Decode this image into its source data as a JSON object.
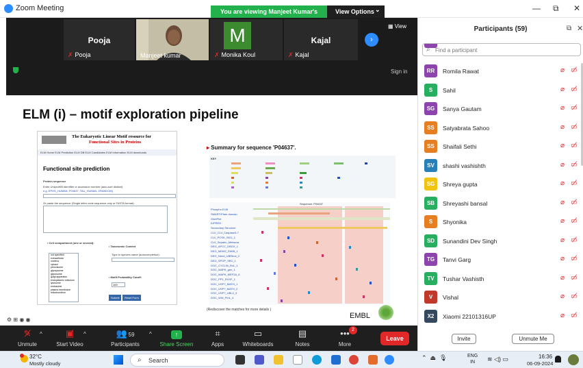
{
  "window": {
    "title": "Zoom Meeting",
    "share_banner": "You are viewing Manjeet Kumar's screen",
    "view_options": "View Options",
    "view_options_caret": "⌄",
    "minimize": "—",
    "maximize": "⧉",
    "close": "✕"
  },
  "gallery": {
    "tiles": [
      {
        "name": "Pooja",
        "label": "Pooja"
      },
      {
        "name": "",
        "label": "Manjeet kumar"
      },
      {
        "name": "M",
        "label": "Monika Koul"
      },
      {
        "name": "Kajal",
        "label": "Kajal"
      }
    ],
    "next_arrow": "›",
    "view_button": "▦ View",
    "sign_in": "Sign in",
    "mute_glyph": "✗"
  },
  "slide": {
    "title": "ELM (i) – motif exploration pipeline",
    "elm": {
      "name": "The Eukaryotic Linear Motif resource for",
      "subtitle": "Functional Sites in Proteins",
      "nav": "ELM Home   ELM Prediction   ELM DB   ELM Candidates   ELM Information   ELM downloads",
      "heading": "Functional site prediction",
      "protein_seq": "Protein sequence",
      "enter_hint": "Enter UniprotKB identifier or accession number (auto-sort distinct)",
      "example": "e.g. EPHS_HUMAN, P04637, TAU_HUMAN, ZRANDOM)",
      "paste_hint": "Or paste the sequence (Single letter code sequence only or FASTA format):",
      "cell_compartment": "• Cell compartment (one or several):",
      "taxonomic": "• Taxonomic Context",
      "species_hint": "Type in species name (autocompletion):",
      "motif_prob": "• Motif Probability Cutoff:",
      "cutoff": "100",
      "submit": "Submit",
      "reset": "Reset Form",
      "compartments": "not specified\nextracellular\nnucleus\ncytosol\nperoxisome\nglyoxysome\nglycosome\ngolgi apparatus\nendoplasmic reticulum\nlysosome\nendosome\nplasma membrane\nmitochondrion"
    },
    "summary": {
      "title": "Summary for sequence 'P04637'.",
      "key": "KEY",
      "footer": "(Rediscover the matches for more details )",
      "sequence_label": "Sequence: P04637",
      "rows": [
        "Phospho.ELM",
        "SMART/Pfam domain",
        "GlobPlot",
        "IUPRED",
        "Secondary Structure",
        "CLV_C14_Caspase3-7",
        "CLV_PCSK_SKI1_1",
        "CLV_Separin_Metazoa",
        "DEG_APCC_DBOX_1",
        "DEG_MDM2_SWIB_1",
        "DEG_Nend_UBRbox_2",
        "DEG_SPOP_SBC_1",
        "DOC_CYCLIN_RxL_1",
        "DOC_MAPK_gen_1",
        "DOC_MAPK_MEF2A_6",
        "DOC_PP1_RVXF_1",
        "DOC_USP7_MATH_1",
        "DOC_USP7_MATH_2",
        "DOC_USP7_UBL2_3",
        "DOC_WW_Pin1_4"
      ]
    },
    "embl": "EMBL",
    "annot_icons": "⚙ ⊞ ◉ ◉"
  },
  "toolbar": {
    "unmute": "Unmute",
    "start_video": "Start Video",
    "participants": "Participants",
    "participants_count": "59",
    "share_screen": "Share Screen",
    "apps": "Apps",
    "whiteboards": "Whiteboards",
    "notes": "Notes",
    "more": "More",
    "more_badge": "2",
    "leave": "Leave",
    "caret": "^"
  },
  "panel": {
    "title": "Participants (59)",
    "search_placeholder": "Find a participant",
    "invite": "Invite",
    "unmute_me": "Unmute Me",
    "participants": [
      {
        "initials": "RR",
        "name": "Romila Rawat",
        "color": "#8e44ad"
      },
      {
        "initials": "S",
        "name": "Sahil",
        "color": "#27ae60"
      },
      {
        "initials": "SG",
        "name": "Sanya Gautam",
        "color": "#8e44ad"
      },
      {
        "initials": "SS",
        "name": "Satyabrata Sahoo",
        "color": "#e67e22"
      },
      {
        "initials": "SS",
        "name": "Shaifali Sethi",
        "color": "#e67e22"
      },
      {
        "initials": "SV",
        "name": "shashi vashishth",
        "color": "#2980b9"
      },
      {
        "initials": "SG",
        "name": "Shreya gupta",
        "color": "#f1c40f"
      },
      {
        "initials": "SB",
        "name": "Shreyashi bansal",
        "color": "#27ae60"
      },
      {
        "initials": "S",
        "name": "Shyonika",
        "color": "#e67e22"
      },
      {
        "initials": "SD",
        "name": "Sunandini Dev Singh",
        "color": "#27ae60"
      },
      {
        "initials": "TG",
        "name": "Tanvi Garg",
        "color": "#8e44ad"
      },
      {
        "initials": "TV",
        "name": "Tushar Vashisth",
        "color": "#27ae60"
      },
      {
        "initials": "V",
        "name": "Vishal",
        "color": "#c0392b"
      },
      {
        "initials": "X2",
        "name": "Xiaomi 22101316UP",
        "color": "#34495e"
      }
    ]
  },
  "taskbar": {
    "temp": "32°C",
    "weather": "Mostly cloudy",
    "search": "Search",
    "lang_top": "ENG",
    "lang_bottom": "IN",
    "time": "16:36",
    "date": "06-09-2024"
  }
}
